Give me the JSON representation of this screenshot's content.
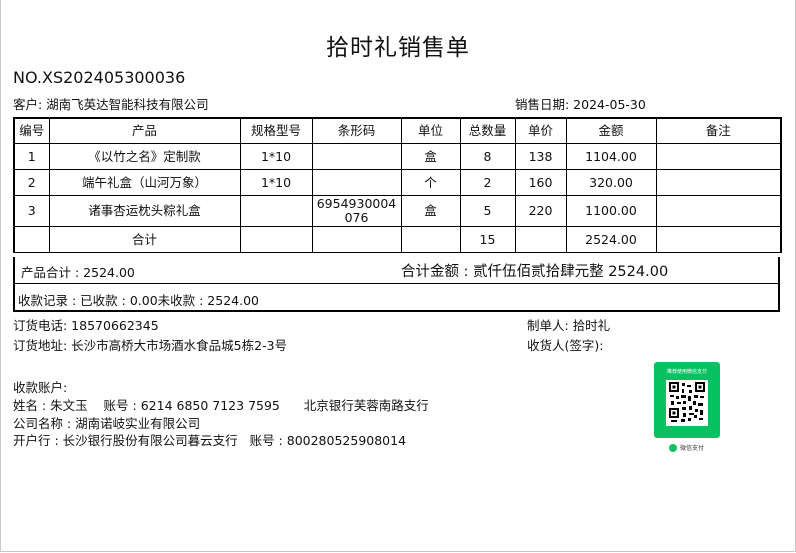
{
  "title": "拾时礼销售单",
  "order_no": "NO.XS202405300036",
  "customer": "客户: 湖南飞英达智能科技有限公司",
  "sale_date": "销售日期: 2024-05-30",
  "table": {
    "headers": [
      "编号",
      "产品",
      "规格型号",
      "条形码",
      "单位",
      "总数量",
      "单价",
      "金额",
      "备注"
    ],
    "rows": [
      [
        "1",
        "《以竹之名》定制款",
        "1*10",
        "",
        "盒",
        "8",
        "138",
        "1104.00",
        ""
      ],
      [
        "2",
        "端午礼盒（山河万象）",
        "1*10",
        "",
        "个",
        "2",
        "160",
        "320.00",
        ""
      ],
      [
        "3",
        "诸事杏运枕头粽礼盒",
        "",
        "6954930004076",
        "盒",
        "5",
        "220",
        "1100.00",
        ""
      ]
    ],
    "total_row": {
      "label": "合计",
      "quantity": "15",
      "amount": "2524.00"
    }
  },
  "product_total": "产品合计 : 2524.00",
  "grand_total": "合计金额 : 贰仟伍佰贰拾肆元整 2524.00",
  "payment_record": "收款记录 : 已收款 : 0.00未收款 : 2524.00",
  "order_phone": "订货电话: 18570662345",
  "maker": "制单人: 拾时礼",
  "order_address": "订货地址: 长沙市高桥大市场酒水食品城5栋2-3号",
  "receiver": "收货人(签字):",
  "accounts_label": "收款账户:",
  "account_1": "姓名 : 朱文玉    账号 : 6214 6850 7123 7595      北京银行芙蓉南路支行",
  "company": "公司名称 : 湖南诺岐实业有限公司",
  "account_2": "开户行 : 长沙银行股份有限公司暮云支行   账号 : 800280525908014",
  "qr": {
    "header": "推荐使用微信支付",
    "footer": "",
    "brand": "微信支付",
    "icon": "wechat-pay-icon",
    "accent": "#08c160"
  }
}
